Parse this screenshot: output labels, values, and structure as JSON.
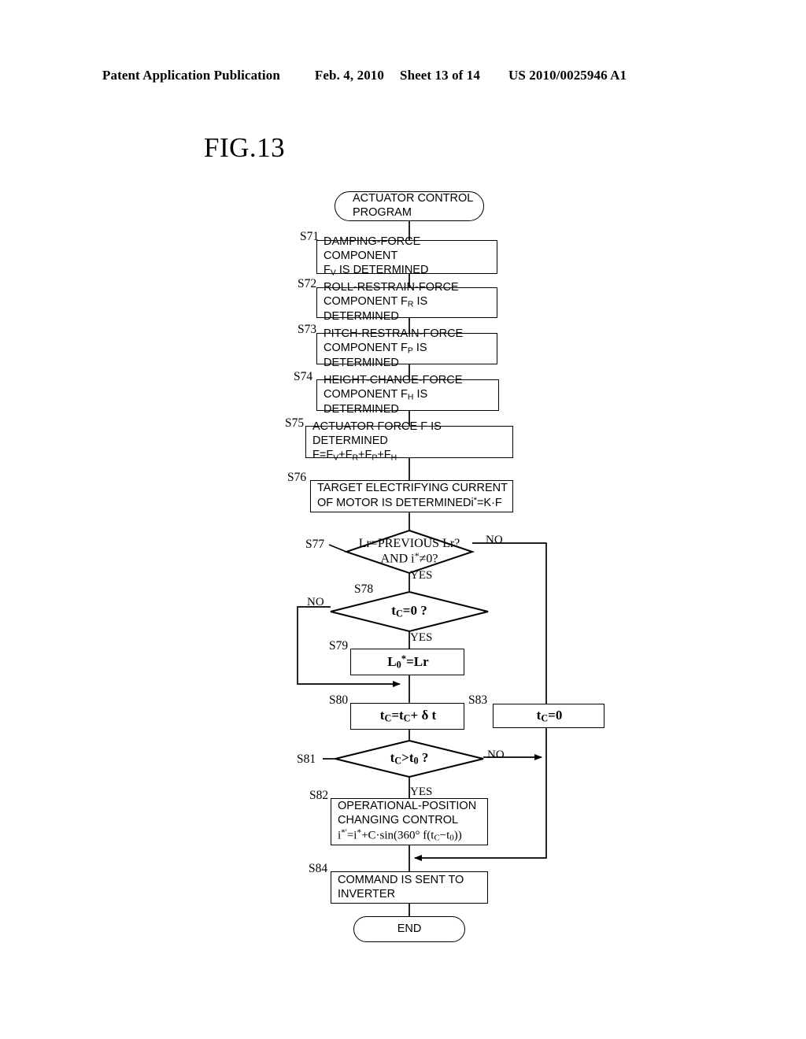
{
  "header": {
    "publication": "Patent Application Publication",
    "date": "Feb. 4, 2010",
    "sheet": "Sheet 13 of 14",
    "patent_number": "US 2010/0025946 A1"
  },
  "figure": {
    "title": "FIG.13"
  },
  "flowchart": {
    "start": {
      "id": "",
      "line1": "ACTUATOR CONTROL",
      "line2": "PROGRAM"
    },
    "steps": [
      {
        "id": "S71",
        "type": "process",
        "line1": "DAMPING-FORCE COMPONENT",
        "line2": "F",
        "line2_sub": "V",
        "line2_rest": " IS DETERMINED"
      },
      {
        "id": "S72",
        "type": "process",
        "line1": "ROLL-RESTRAIN-FORCE",
        "line2": "COMPONENT F",
        "line2_sub": "R",
        "line2_rest": " IS DETERMINED"
      },
      {
        "id": "S73",
        "type": "process",
        "line1": "PITCH-RESTRAIN-FORCE",
        "line2": "COMPONENT F",
        "line2_sub": "P",
        "line2_rest": " IS DETERMINED"
      },
      {
        "id": "S74",
        "type": "process",
        "line1": "HEIGHT-CHANGE-FORCE",
        "line2": "COMPONENT F",
        "line2_sub": "H",
        "line2_rest": " IS DETERMINED"
      },
      {
        "id": "S75",
        "type": "process",
        "line1": "ACTUATOR FORCE F IS DETERMINED",
        "formula": "F=F_V+F_R+F_P+F_H"
      },
      {
        "id": "S76",
        "type": "process",
        "line1": "TARGET ELECTRIFYING CURRENT",
        "line2": "OF MOTOR IS DETERMINEDi*=K·F"
      },
      {
        "id": "S77",
        "type": "decision",
        "line1": "Lr=PREVIOUS Lr?",
        "line2": "AND  i*≠0?",
        "yes_label": "YES",
        "no_label": "NO"
      },
      {
        "id": "S78",
        "type": "decision",
        "line1": "t_C=0 ?",
        "yes_label": "YES",
        "no_label": "NO"
      },
      {
        "id": "S79",
        "type": "process",
        "formula": "L_0*=Lr"
      },
      {
        "id": "S80",
        "type": "process",
        "formula": "t_C=t_C+ δ t"
      },
      {
        "id": "S81",
        "type": "decision",
        "line1": "t_C>t_0 ?",
        "yes_label": "YES",
        "no_label": "NO"
      },
      {
        "id": "S82",
        "type": "process",
        "line1": "OPERATIONAL-POSITION",
        "line2": "CHANGING CONTROL",
        "formula": "i*'=i*+C·sin(360°  f(t_C−t_0))"
      },
      {
        "id": "S83",
        "type": "process",
        "formula": "t_C=0"
      },
      {
        "id": "S84",
        "type": "process",
        "line1": "COMMAND IS SENT TO",
        "line2": "INVERTER"
      }
    ],
    "end": {
      "label": "END"
    }
  },
  "text_fragments": {
    "s71_l2_a": "F",
    "s71_l2_sub": "V",
    "s71_l2_b": " IS DETERMINED",
    "s72_l2_a": "COMPONENT F",
    "s72_l2_sub": "R",
    "s72_l2_b": " IS DETERMINED",
    "s73_l2_a": "COMPONENT F",
    "s73_l2_sub": "P",
    "s73_l2_b": " IS DETERMINED",
    "s74_l2_a": "COMPONENT F",
    "s74_l2_sub": "H",
    "s74_l2_b": " IS DETERMINED",
    "s75_f_a": "F=F",
    "s75_f_s1": "V",
    "s75_f_b": "+F",
    "s75_f_s2": "R",
    "s75_f_c": "+F",
    "s75_f_s3": "P",
    "s75_f_d": "+F",
    "s75_f_s4": "H",
    "s76_l2_a": "OF MOTOR IS DETERMINEDi",
    "s76_l2_sup": "*",
    "s76_l2_b": "=K·F",
    "s77_l1": "Lr=PREVIOUS Lr?",
    "s77_l2_a": "AND  i",
    "s77_l2_sup": "*",
    "s77_l2_b": "≠0?",
    "s78_a": "t",
    "s78_sub": "C",
    "s78_b": "=0 ?",
    "s79_a": "L",
    "s79_sub": "0",
    "s79_sup": "*",
    "s79_b": "=Lr",
    "s80_a": "t",
    "s80_s1": "C",
    "s80_b": "=t",
    "s80_s2": "C",
    "s80_c": "+ δ t",
    "s81_a": "t",
    "s81_s1": "C",
    "s81_b": ">t",
    "s81_s2": "0",
    "s81_c": " ?",
    "s82_f_a": "i",
    "s82_f_sup1": "*'",
    "s82_f_b": "=i",
    "s82_f_sup2": "*",
    "s82_f_c": "+C·sin(360°  f(t",
    "s82_f_s1": "C",
    "s82_f_d": "−t",
    "s82_f_s2": "0",
    "s82_f_e": "))",
    "s83_a": "t",
    "s83_sub": "C",
    "s83_b": "=0"
  },
  "branch_labels": {
    "s77_no": "NO",
    "s77_yes": "YES",
    "s78_no": "NO",
    "s78_yes": "YES",
    "s81_no": "NO",
    "s81_yes": "YES"
  },
  "step_ids": {
    "s71": "S71",
    "s72": "S72",
    "s73": "S73",
    "s74": "S74",
    "s75": "S75",
    "s76": "S76",
    "s77": "S77",
    "s78": "S78",
    "s79": "S79",
    "s80": "S80",
    "s81": "S81",
    "s82": "S82",
    "s83": "S83",
    "s84": "S84"
  },
  "colors": {
    "ink": "#000000",
    "paper": "#ffffff"
  }
}
